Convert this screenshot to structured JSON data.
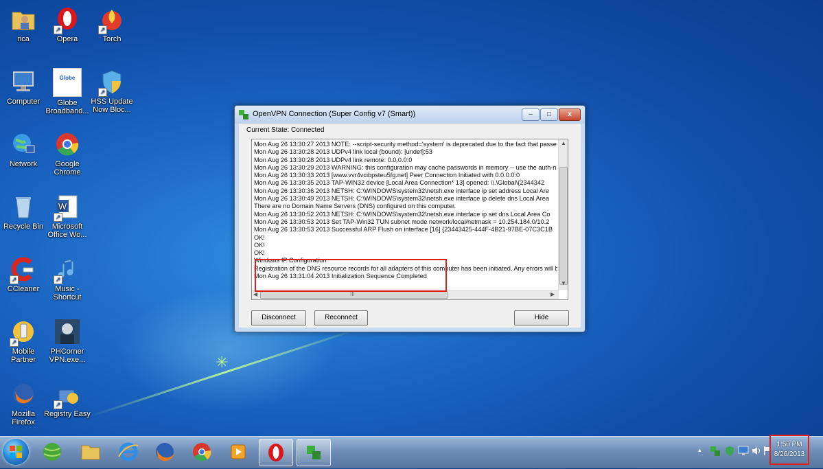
{
  "desktop": {
    "icons": [
      {
        "label": "rica"
      },
      {
        "label": "Opera"
      },
      {
        "label": "Torch"
      },
      {
        "label": "Computer"
      },
      {
        "label": "Globe Broadband..."
      },
      {
        "label": "HSS Update Now Bloc..."
      },
      {
        "label": "Network"
      },
      {
        "label": "Google Chrome"
      },
      {
        "label": "Recycle Bin"
      },
      {
        "label": "Microsoft Office Wo..."
      },
      {
        "label": "CCleaner"
      },
      {
        "label": "Music - Shortcut"
      },
      {
        "label": "Mobile Partner"
      },
      {
        "label": "PHCorner VPN.exe..."
      },
      {
        "label": "Mozilla Firefox"
      },
      {
        "label": "Registry Easy"
      }
    ],
    "globe_logo_text": "Globe"
  },
  "window": {
    "title": "OpenVPN Connection (Super Config v7 (Smart))",
    "state_label": "Current State: Connected",
    "minimize": "–",
    "maximize": "□",
    "close": "x",
    "log_lines": [
      "Mon Aug 26 13:30:27 2013 NOTE: --script-security method='system' is deprecated due to the fact that passe",
      "Mon Aug 26 13:30:28 2013 UDPv4 link local (bound): [undef]:53",
      "Mon Aug 26 13:30:28 2013 UDPv4 link remote: 0.0.0.0:0",
      "Mon Aug 26 13:30:29 2013 WARNING: this configuration may cache passwords in memory -- use the auth-n",
      "Mon Aug 26 13:30:33 2013 [www.vvr4vcibpsteu5fg.net] Peer Connection Initiated with 0.0.0.0:0",
      "Mon Aug 26 13:30:35 2013 TAP-WIN32 device [Local Area Connection* 13] opened: \\\\.\\Global\\{2344342",
      "Mon Aug 26 13:30:36 2013 NETSH: C:\\WINDOWS\\system32\\netsh.exe interface ip set address Local Are",
      "Mon Aug 26 13:30:49 2013 NETSH: C:\\WINDOWS\\system32\\netsh.exe interface ip delete dns Local Area",
      "There are no Domain Name Servers (DNS) configured on this computer.",
      "Mon Aug 26 13:30:52 2013 NETSH: C:\\WINDOWS\\system32\\netsh.exe interface ip set dns Local Area Co",
      "Mon Aug 26 13:30:53 2013 Set TAP-Win32 TUN subnet mode network/local/netmask = 10.254.184.0/10.2",
      "Mon Aug 26 13:30:53 2013 Successful ARP Flush on interface [16] {23443425-444F-4B21-97BE-07C3C1B",
      " OK!",
      " OK!",
      " OK!",
      "Windows IP Configuration",
      "Registration of the DNS resource records for all adapters of this computer has been initiated. Any errors will b",
      "Mon Aug 26 13:31:04 2013 Initialization Sequence Completed"
    ],
    "scroll_mid_glyph": "III",
    "buttons": {
      "disconnect": "Disconnect",
      "reconnect": "Reconnect",
      "hide": "Hide"
    }
  },
  "taskbar": {
    "tray_glyphs": [
      "▴"
    ],
    "clock_time": "1:50 PM",
    "clock_date": "8/26/2013"
  }
}
